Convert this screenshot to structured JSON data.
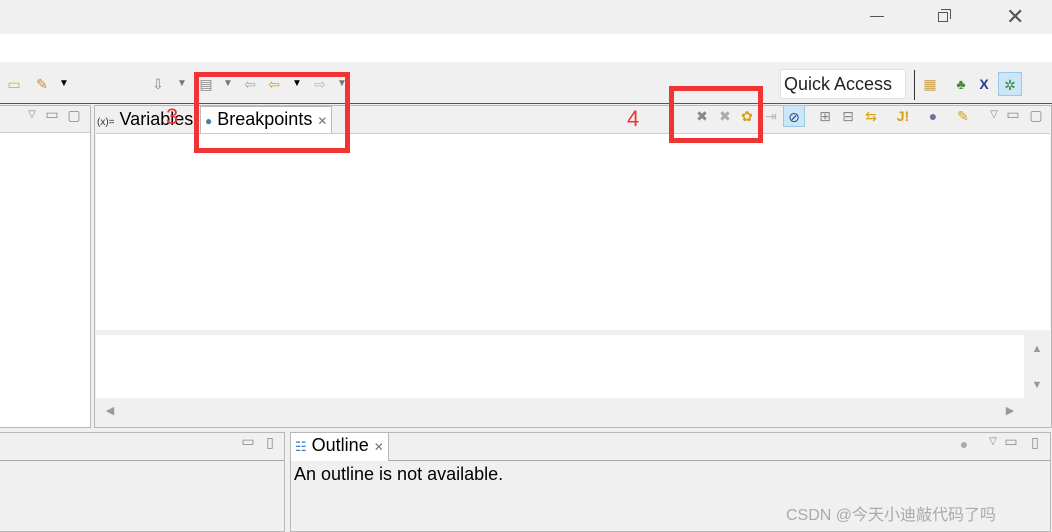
{
  "window": {
    "minimize_icon": "minimize-icon",
    "restore_icon": "restore-icon",
    "close_icon": "close-icon"
  },
  "toolbar": {
    "quick_access": "Quick Access"
  },
  "views": {
    "tabs": [
      {
        "label": "Variables",
        "icon": "(x)="
      },
      {
        "label": "Breakpoints"
      }
    ],
    "annotation_3": "3",
    "annotation_4": "4",
    "accent": "#f03434"
  },
  "outline": {
    "tab_label": "Outline",
    "message": "An outline is not available."
  },
  "watermark": "CSDN @今天小迪敲代码了吗"
}
